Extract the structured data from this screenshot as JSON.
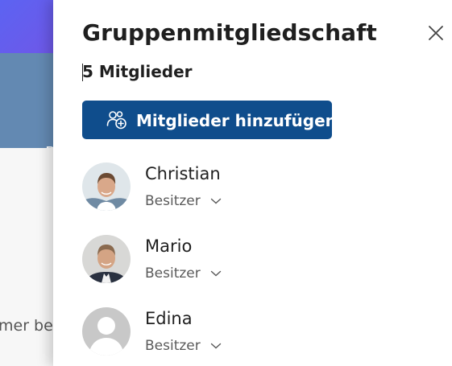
{
  "background": {
    "banner_text": "P",
    "content_text": "mer be"
  },
  "panel": {
    "title": "Gruppenmitgliedschaft",
    "member_count_label": "5 Mitglieder",
    "add_button_label": "Mitglieder hinzufügen",
    "close_icon": "close-icon",
    "add_icon": "people-add-icon"
  },
  "members": [
    {
      "name": "Christian",
      "role": "Besitzer",
      "avatar": "photo"
    },
    {
      "name": "Mario",
      "role": "Besitzer",
      "avatar": "photo"
    },
    {
      "name": "Edina",
      "role": "Besitzer",
      "avatar": "placeholder"
    }
  ],
  "colors": {
    "accent": "#0f4d8c",
    "banner": "#6389b2",
    "header": "#5c63f2"
  }
}
